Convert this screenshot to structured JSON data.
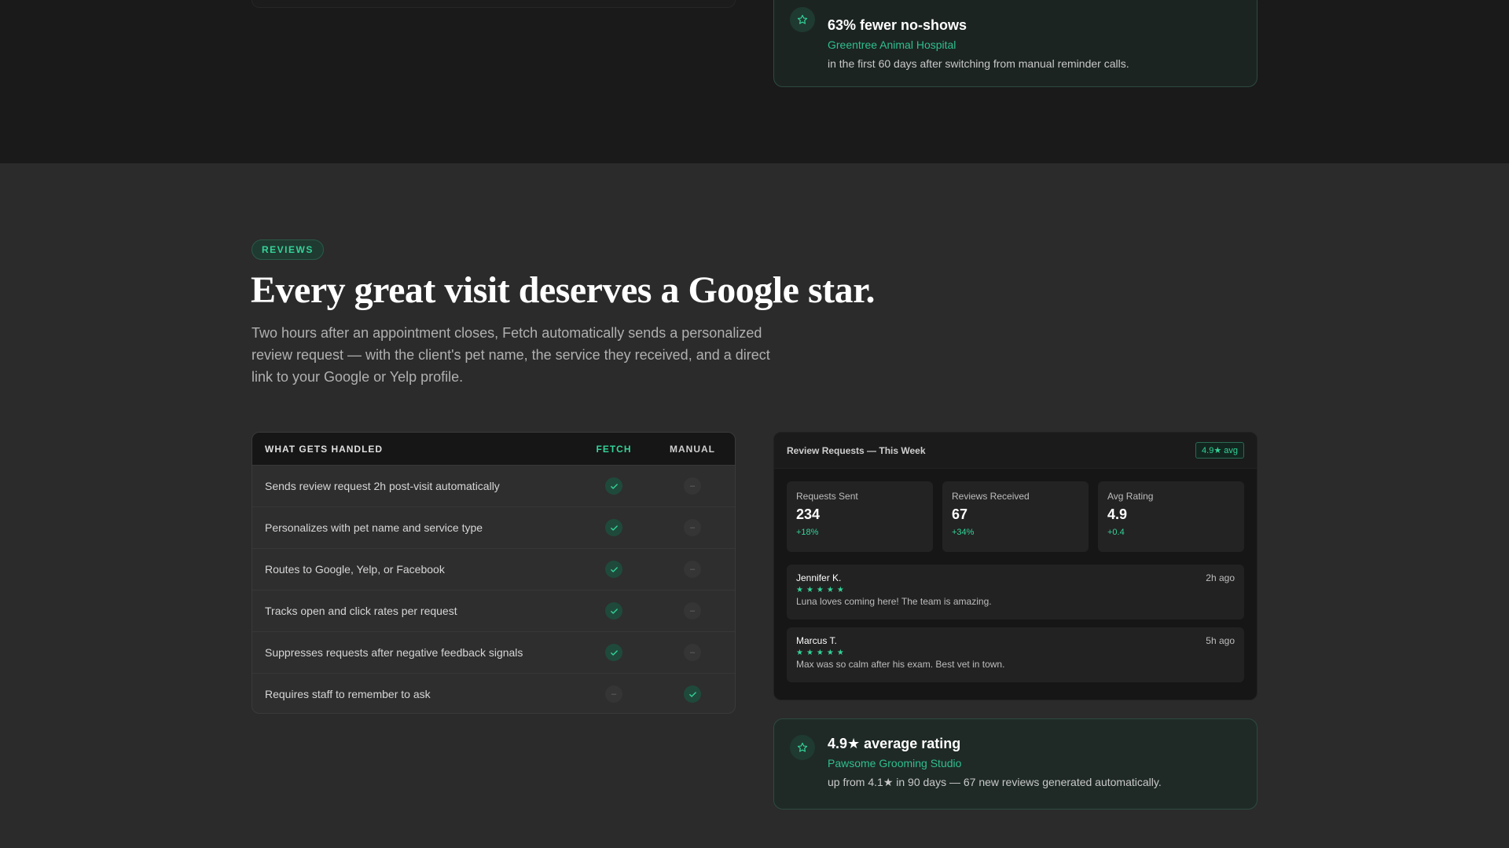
{
  "top_testimonial": {
    "icon": "star-icon",
    "title": "63% fewer no-shows",
    "org": "Greentree Animal Hospital",
    "desc": "in the first 60 days after switching from manual reminder calls."
  },
  "section": {
    "tag": "REVIEWS",
    "headline": "Every great visit deserves a Google star.",
    "lede": "Two hours after an appointment closes, Fetch automatically sends a personalized review request — with the client's pet name, the service they received, and a direct link to your Google or Yelp profile."
  },
  "comparison": {
    "headers": [
      "WHAT GETS HANDLED",
      "FETCH",
      "MANUAL"
    ],
    "rows": [
      {
        "label": "Sends review request 2h post-visit automatically",
        "fetch": true,
        "manual": false
      },
      {
        "label": "Personalizes with pet name and service type",
        "fetch": true,
        "manual": false
      },
      {
        "label": "Routes to Google, Yelp, or Facebook",
        "fetch": true,
        "manual": false
      },
      {
        "label": "Tracks open and click rates per request",
        "fetch": true,
        "manual": false
      },
      {
        "label": "Suppresses requests after negative feedback signals",
        "fetch": true,
        "manual": false
      },
      {
        "label": "Requires staff to remember to ask",
        "fetch": false,
        "manual": true
      }
    ],
    "dash_symbol": "–"
  },
  "dashboard": {
    "title": "Review Requests — This Week",
    "badge": "4.9★ avg",
    "stats": [
      {
        "label": "Requests Sent",
        "value": "234",
        "delta": "+18%"
      },
      {
        "label": "Reviews Received",
        "value": "67",
        "delta": "+34%"
      },
      {
        "label": "Avg Rating",
        "value": "4.9",
        "delta": "+0.4"
      }
    ],
    "reviews": [
      {
        "name": "Jennifer K.",
        "time": "2h ago",
        "stars": "★★★★★",
        "rating": 5,
        "text": "Luna loves coming here! The team is amazing."
      },
      {
        "name": "Marcus T.",
        "time": "5h ago",
        "stars": "★★★★★",
        "rating": 5,
        "text": "Max was so calm after his exam. Best vet in town."
      }
    ]
  },
  "bottom_testimonial": {
    "icon": "star-icon",
    "title": "4.9★ average rating",
    "org": "Pawsome Grooming Studio",
    "desc": "up from 4.1★ in 90 days — 67 new reviews generated automatically."
  },
  "colors": {
    "accent": "#34d399",
    "background": "#2b2b2b",
    "top_band": "#1a1a1a"
  }
}
